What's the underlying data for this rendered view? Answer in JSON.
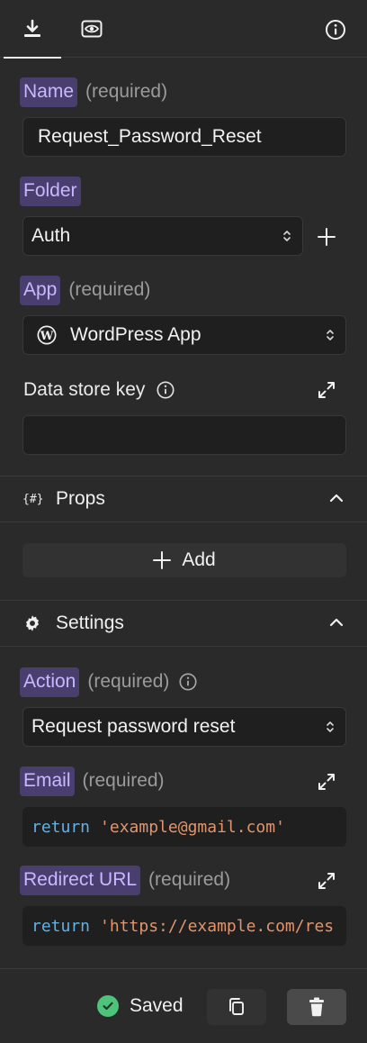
{
  "tabs": [
    {
      "icon": "download-icon",
      "active": true
    },
    {
      "icon": "eye-preview-icon",
      "active": false
    }
  ],
  "info_icon": "info-circle-icon",
  "name": {
    "label": "Name",
    "hint": "(required)",
    "value": "Request_Password_Reset"
  },
  "folder": {
    "label": "Folder",
    "value": "Auth"
  },
  "app": {
    "label": "App",
    "hint": "(required)",
    "value": "WordPress App",
    "icon": "wordpress-icon"
  },
  "datastore": {
    "label": "Data store key",
    "value": ""
  },
  "props": {
    "title": "Props",
    "icon_text": "{#}",
    "add_label": "Add"
  },
  "settings": {
    "title": "Settings",
    "action": {
      "label": "Action",
      "hint": "(required)",
      "value": "Request password reset"
    },
    "email": {
      "label": "Email",
      "hint": "(required)",
      "code_kw": "return",
      "code_str": "'example@gmail.com'"
    },
    "redirect": {
      "label": "Redirect URL",
      "hint": "(required)",
      "code_kw": "return",
      "code_str": "'https://example.com/res"
    }
  },
  "footer": {
    "status": "Saved"
  },
  "colors": {
    "chip_bg": "#4a3e6e",
    "chip_text": "#c9b8ff",
    "saved_green": "#4ec37a",
    "code_keyword": "#5fb3e6",
    "code_string": "#e0956d"
  }
}
